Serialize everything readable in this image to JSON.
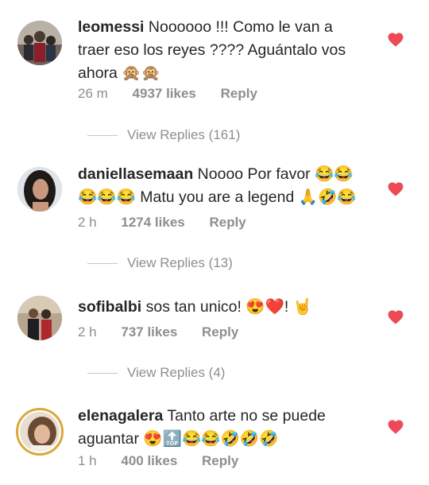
{
  "comments": [
    {
      "username": "leomessi",
      "text": "Noooooo !!! Como le van a traer eso los reyes ???? Aguántalo vos ahora 🙊🙊",
      "time": "26 m",
      "likes": "4937 likes",
      "reply": "Reply",
      "view_replies": "View Replies (161)"
    },
    {
      "username": "daniellasemaan",
      "text": "Noooo Por favor 😂😂😂😂😂 Matu you are a legend 🙏🤣😂",
      "time": "2 h",
      "likes": "1274 likes",
      "reply": "Reply",
      "view_replies": "View Replies (13)"
    },
    {
      "username": "sofibalbi",
      "text": "sos tan unico! 😍❤️! 🤘",
      "time": "2 h",
      "likes": "737 likes",
      "reply": "Reply",
      "view_replies": "View Replies (4)"
    },
    {
      "username": "elenagalera",
      "text": "Tanto arte no se puede aguantar 😍🔝😂😂🤣🤣🤣",
      "time": "1 h",
      "likes": "400 likes",
      "reply": "Reply"
    }
  ],
  "colors": {
    "heart": "#ed4956",
    "muted": "#8e8e8e",
    "story_ring": "#d9a93a"
  }
}
